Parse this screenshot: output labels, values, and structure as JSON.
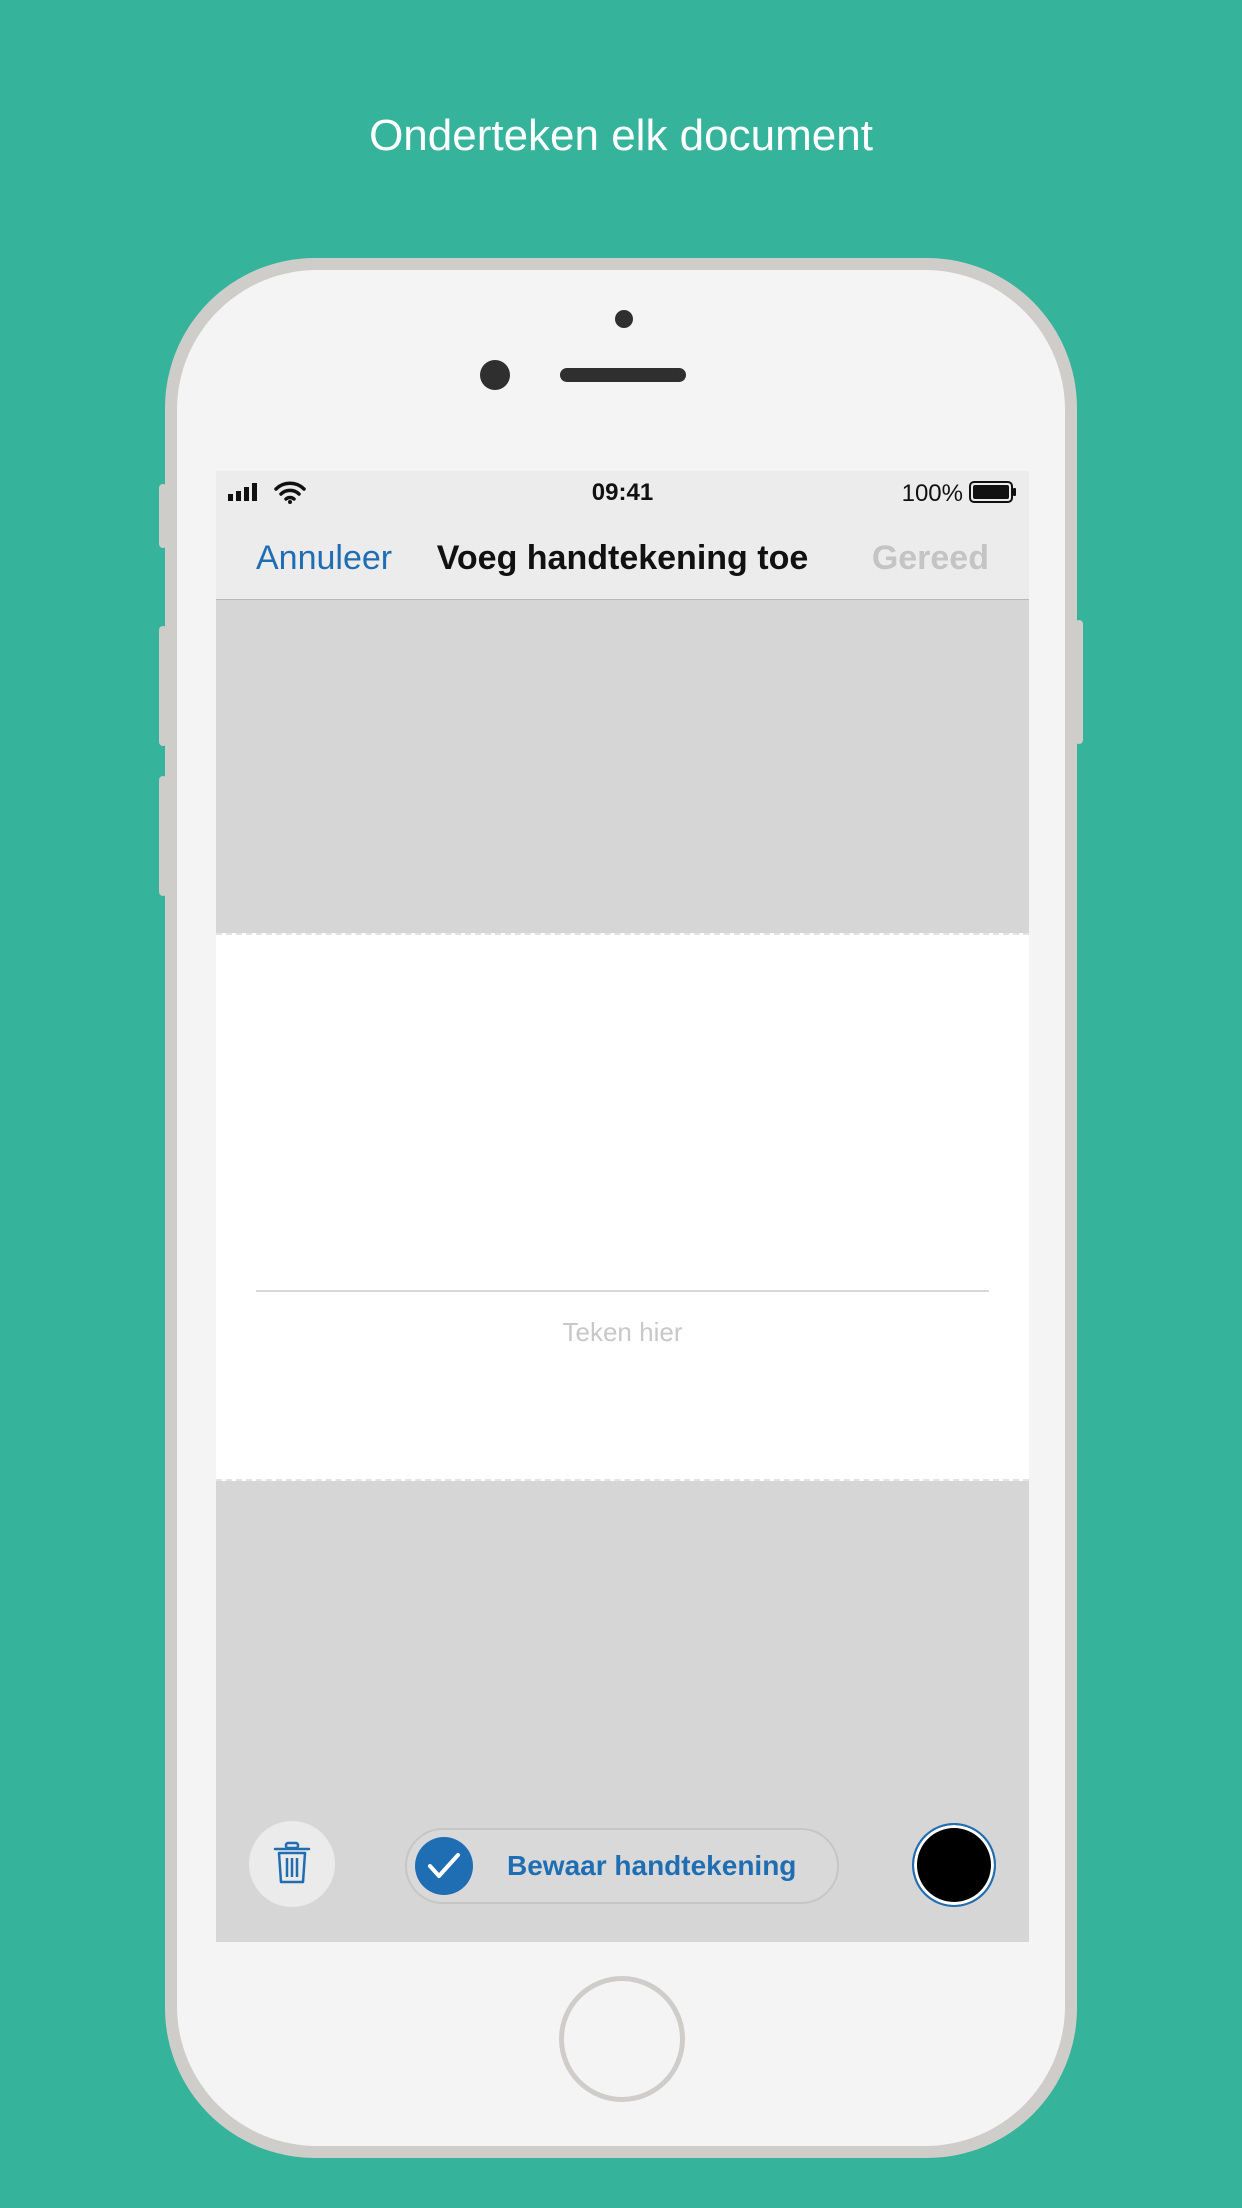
{
  "headline": "Onderteken elk document",
  "status_bar": {
    "time": "09:41",
    "battery_percent": "100%",
    "icons": [
      "cellular-signal-icon",
      "wifi-icon",
      "battery-icon"
    ]
  },
  "nav": {
    "cancel_label": "Annuleer",
    "title": "Voeg handtekening toe",
    "done_label": "Gereed"
  },
  "signature_area": {
    "hint": "Teken hier"
  },
  "toolbar": {
    "delete_icon": "trash-icon",
    "save_label": "Bewaar handtekening",
    "save_checked": true,
    "ink_color": "#000000"
  },
  "colors": {
    "background": "#35b39b",
    "accent": "#1f6eb3",
    "done_disabled": "#c4c4c4"
  }
}
